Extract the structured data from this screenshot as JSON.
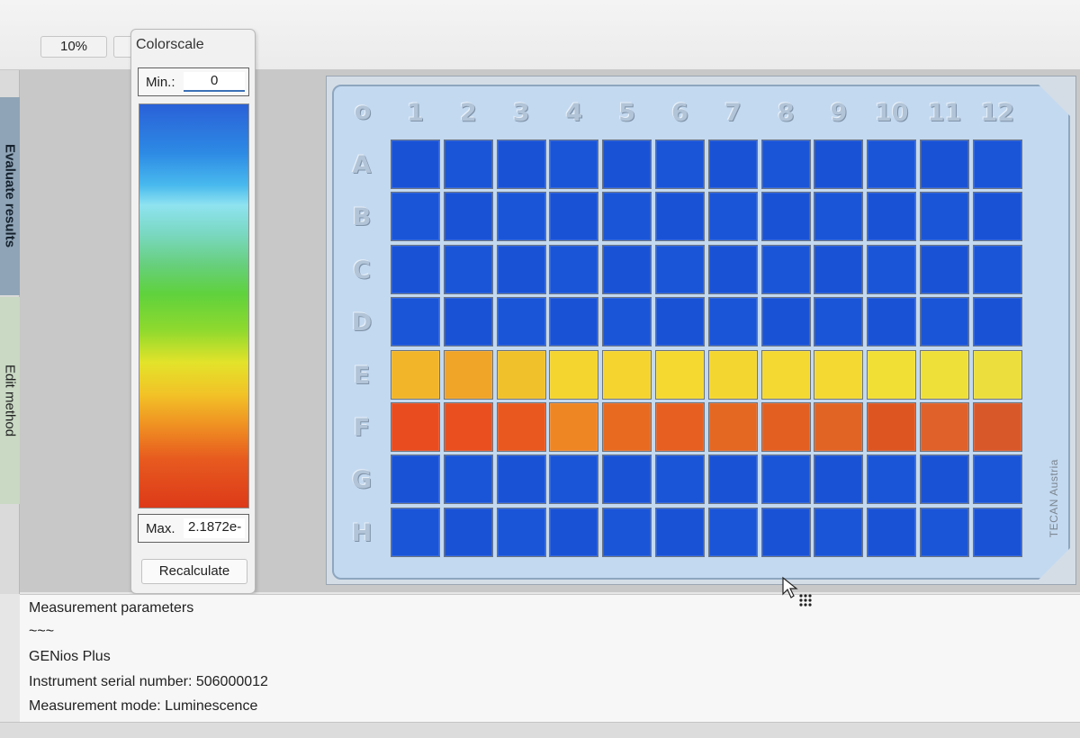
{
  "toolbar": {
    "zoom_label": "10%"
  },
  "side_tabs": {
    "evaluate": "Evaluate results",
    "edit": "Edit method"
  },
  "colorscale": {
    "title": "Colorscale",
    "min_label": "Min.:",
    "min_value": "0",
    "max_label": "Max.",
    "max_value": "2.1872e-",
    "recalculate": "Recalculate"
  },
  "plate": {
    "corner_label": "o",
    "columns": [
      "1",
      "2",
      "3",
      "4",
      "5",
      "6",
      "7",
      "8",
      "9",
      "10",
      "11",
      "12"
    ],
    "rows": [
      "A",
      "B",
      "C",
      "D",
      "E",
      "F",
      "G",
      "H"
    ],
    "brand": "TECAN Austria",
    "well_colors": [
      [
        "#1a52d6",
        "#1a55d8",
        "#1a52d6",
        "#1a55d8",
        "#1a52d6",
        "#1a55d8",
        "#1a52d6",
        "#1a55d8",
        "#1a52d6",
        "#1a55d8",
        "#1a52d6",
        "#1a55d8"
      ],
      [
        "#1a55d8",
        "#1a52d6",
        "#1a55d8",
        "#1a52d6",
        "#1a55d8",
        "#1a52d6",
        "#1a55d8",
        "#1a52d6",
        "#1a55d8",
        "#1a52d6",
        "#1a55d8",
        "#1a52d6"
      ],
      [
        "#1a52d6",
        "#1a55d8",
        "#1a52d6",
        "#1a55d8",
        "#1a52d6",
        "#1a55d8",
        "#1a52d6",
        "#1a55d8",
        "#1a52d6",
        "#1a55d8",
        "#1a52d6",
        "#1a55d8"
      ],
      [
        "#1a55d8",
        "#1a52d6",
        "#1a55d8",
        "#1a52d6",
        "#1a55d8",
        "#1a52d6",
        "#1a55d8",
        "#1a52d6",
        "#1a55d8",
        "#1a52d6",
        "#1a55d8",
        "#1a52d6"
      ],
      [
        "#f2b52a",
        "#f0a428",
        "#f1c12b",
        "#f4d42e",
        "#f5d430",
        "#f5d931",
        "#f4d630",
        "#f4d932",
        "#f3d932",
        "#f2df36",
        "#efe039",
        "#ecdf3d"
      ],
      [
        "#e84c1f",
        "#ea4f1f",
        "#e8581f",
        "#ef8624",
        "#e86a21",
        "#e76021",
        "#e46722",
        "#e35f21",
        "#e26424",
        "#dd5622",
        "#e0612a",
        "#d9582a"
      ],
      [
        "#1a52d6",
        "#1a55d8",
        "#1a52d6",
        "#1a55d8",
        "#1a52d6",
        "#1a55d8",
        "#1a52d6",
        "#1a55d8",
        "#1a52d6",
        "#1a55d8",
        "#1a52d6",
        "#1a55d8"
      ],
      [
        "#1a55d8",
        "#1a52d6",
        "#1a55d8",
        "#1a52d6",
        "#1a55d8",
        "#1a52d6",
        "#1a55d8",
        "#1a52d6",
        "#1a55d8",
        "#1a52d6",
        "#1a55d8",
        "#1a52d6"
      ]
    ]
  },
  "info": {
    "lines": [
      "Measurement parameters",
      "~~~",
      "GENios Plus",
      "Instrument serial number: 506000012",
      "Measurement mode: Luminescence"
    ]
  }
}
